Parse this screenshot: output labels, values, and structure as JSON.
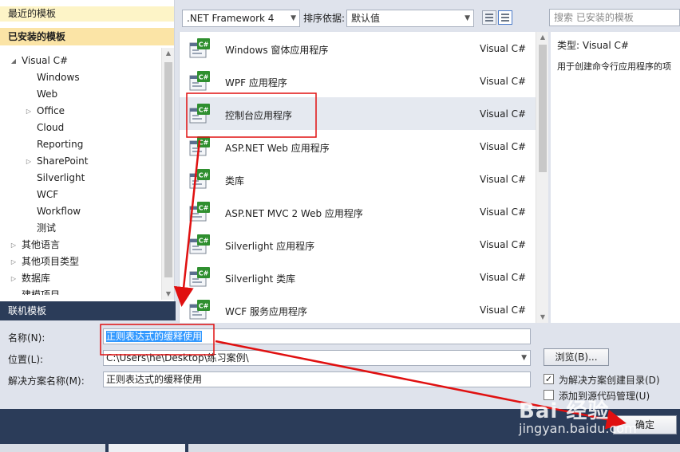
{
  "sidebar": {
    "recent": "最近的模板",
    "installed": "已安装的模板",
    "online": "联机模板",
    "tree": [
      {
        "label": "Visual C#",
        "indent": 0,
        "arrow": "expanded"
      },
      {
        "label": "Windows",
        "indent": 1,
        "arrow": "none"
      },
      {
        "label": "Web",
        "indent": 1,
        "arrow": "none"
      },
      {
        "label": "Office",
        "indent": 1,
        "arrow": "collapsed"
      },
      {
        "label": "Cloud",
        "indent": 1,
        "arrow": "none"
      },
      {
        "label": "Reporting",
        "indent": 1,
        "arrow": "none"
      },
      {
        "label": "SharePoint",
        "indent": 1,
        "arrow": "collapsed"
      },
      {
        "label": "Silverlight",
        "indent": 1,
        "arrow": "none"
      },
      {
        "label": "WCF",
        "indent": 1,
        "arrow": "none"
      },
      {
        "label": "Workflow",
        "indent": 1,
        "arrow": "none"
      },
      {
        "label": "测试",
        "indent": 1,
        "arrow": "none"
      },
      {
        "label": "其他语言",
        "indent": 0,
        "arrow": "collapsed"
      },
      {
        "label": "其他项目类型",
        "indent": 0,
        "arrow": "collapsed"
      },
      {
        "label": "数据库",
        "indent": 0,
        "arrow": "collapsed"
      },
      {
        "label": "建模项目",
        "indent": 0,
        "arrow": "none"
      }
    ]
  },
  "toolbar": {
    "framework": ".NET Framework 4",
    "sort_label": "排序依据:",
    "sort_value": "默认值",
    "search_placeholder": "搜索 已安装的模板"
  },
  "templates": [
    {
      "name": "Windows 窗体应用程序",
      "lang": "Visual C#",
      "icon": "windows-forms-icon"
    },
    {
      "name": "WPF 应用程序",
      "lang": "Visual C#",
      "icon": "wpf-icon"
    },
    {
      "name": "控制台应用程序",
      "lang": "Visual C#",
      "icon": "console-app-icon",
      "selected": true
    },
    {
      "name": "ASP.NET Web 应用程序",
      "lang": "Visual C#",
      "icon": "aspnet-web-icon"
    },
    {
      "name": "类库",
      "lang": "Visual C#",
      "icon": "class-library-icon"
    },
    {
      "name": "ASP.NET MVC 2 Web 应用程序",
      "lang": "Visual C#",
      "icon": "aspnet-mvc-icon"
    },
    {
      "name": "Silverlight 应用程序",
      "lang": "Visual C#",
      "icon": "silverlight-app-icon"
    },
    {
      "name": "Silverlight 类库",
      "lang": "Visual C#",
      "icon": "silverlight-library-icon"
    },
    {
      "name": "WCF 服务应用程序",
      "lang": "Visual C#",
      "icon": "wcf-service-icon"
    }
  ],
  "details": {
    "type_label": "类型:",
    "type_value": "Visual C#",
    "description": "用于创建命令行应用程序的项"
  },
  "form": {
    "name_label": "名称(N):",
    "name_value": "正则表达式的缓释使用",
    "location_label": "位置(L):",
    "location_value": "C:\\Users\\he\\Desktop\\练习案例\\",
    "solution_label": "解决方案名称(M):",
    "solution_value": "正则表达式的缓释使用",
    "browse_label": "浏览(B)...",
    "create_dir_label": "为解决方案创建目录(D)",
    "create_dir_checked": true,
    "source_control_label": "添加到源代码管理(U)",
    "source_control_checked": false,
    "ok_label": "确定"
  },
  "watermark": {
    "brand": "Bai 经验",
    "url": "jingyan.baidu.com"
  },
  "colors": {
    "annotation": "#e01010",
    "selection": "#3399ff",
    "header": "#2b3c59"
  }
}
